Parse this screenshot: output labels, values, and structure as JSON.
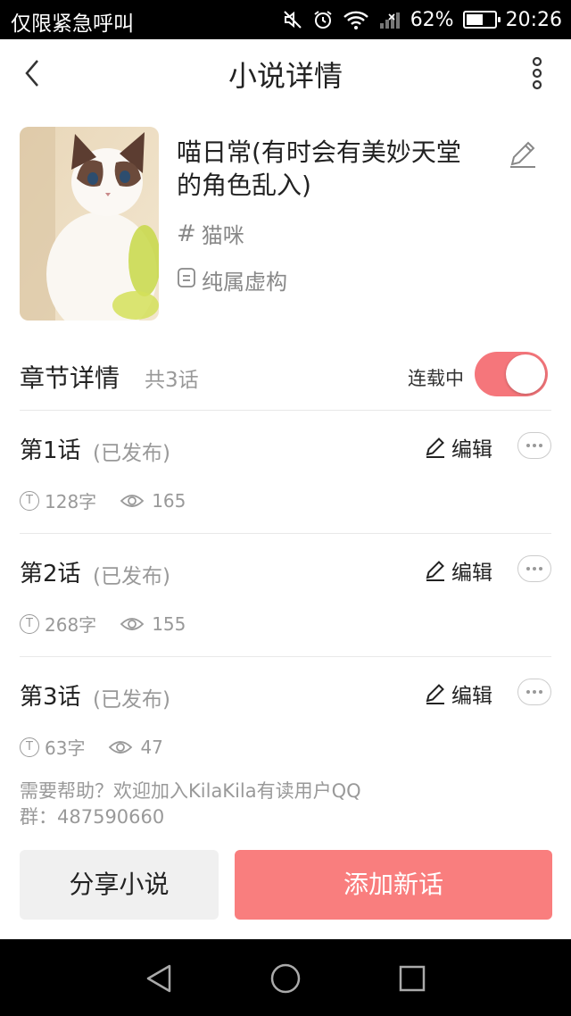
{
  "status_bar": {
    "carrier": "仅限紧急呼叫",
    "battery_percent": "62%",
    "battery_level": 0.62,
    "time": "20:26",
    "icons": [
      "mute-icon",
      "alarm-icon",
      "wifi-icon",
      "signal-icon",
      "battery-icon"
    ]
  },
  "header": {
    "title": "小说详情",
    "back_icon": "back-chevron-icon",
    "more_icon": "more-vertical-icon"
  },
  "novel": {
    "title": "喵日常(有时会有美妙天堂的角色乱入)",
    "tag": "猫咪",
    "type": "纯属虚构",
    "cover": "cat-cover-image"
  },
  "chapters_section": {
    "title": "章节详情",
    "count": "共3话",
    "serial_label": "连载中",
    "serializing": true,
    "accent": "#f5767b"
  },
  "chapters": [
    {
      "name": "第1话",
      "status": "(已发布)",
      "edit_label": "编辑",
      "words": "128字",
      "views": "165"
    },
    {
      "name": "第2话",
      "status": "(已发布)",
      "edit_label": "编辑",
      "words": "268字",
      "views": "155"
    },
    {
      "name": "第3话",
      "status": "(已发布)",
      "edit_label": "编辑",
      "words": "63字",
      "views": "47"
    }
  ],
  "help_text": "需要帮助？欢迎加入KilaKila有读用户QQ群：487590660",
  "buttons": {
    "share": "分享小说",
    "add": "添加新话"
  },
  "nav": [
    "back-triangle-icon",
    "home-circle-icon",
    "recents-square-icon"
  ]
}
